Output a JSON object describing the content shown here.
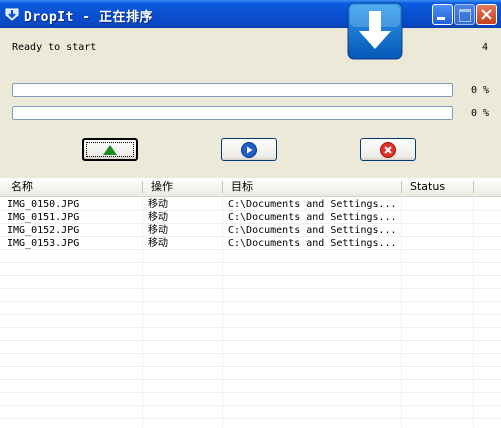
{
  "window": {
    "title": "DropIt - 正在排序"
  },
  "status": {
    "ready_text": "Ready to start",
    "count": "4"
  },
  "progress": [
    {
      "percent_text": "0 %",
      "value": 0
    },
    {
      "percent_text": "0 %",
      "value": 0
    }
  ],
  "buttons": {
    "start_icon": "up-triangle-icon",
    "play_icon": "play-circle-icon",
    "cancel_icon": "cancel-x-icon"
  },
  "colors": {
    "titlebar": "#0A4FD0",
    "window_bg": "#ECE9D8",
    "accent_icon": "#0A73D9"
  },
  "list": {
    "columns": [
      "名称",
      "操作",
      "目标",
      "Status"
    ],
    "rows": [
      [
        "IMG_0150.JPG",
        "移动",
        "C:\\Documents and Settings...",
        ""
      ],
      [
        "IMG_0151.JPG",
        "移动",
        "C:\\Documents and Settings...",
        ""
      ],
      [
        "IMG_0152.JPG",
        "移动",
        "C:\\Documents and Settings...",
        ""
      ],
      [
        "IMG_0153.JPG",
        "移动",
        "C:\\Documents and Settings...",
        ""
      ]
    ]
  }
}
